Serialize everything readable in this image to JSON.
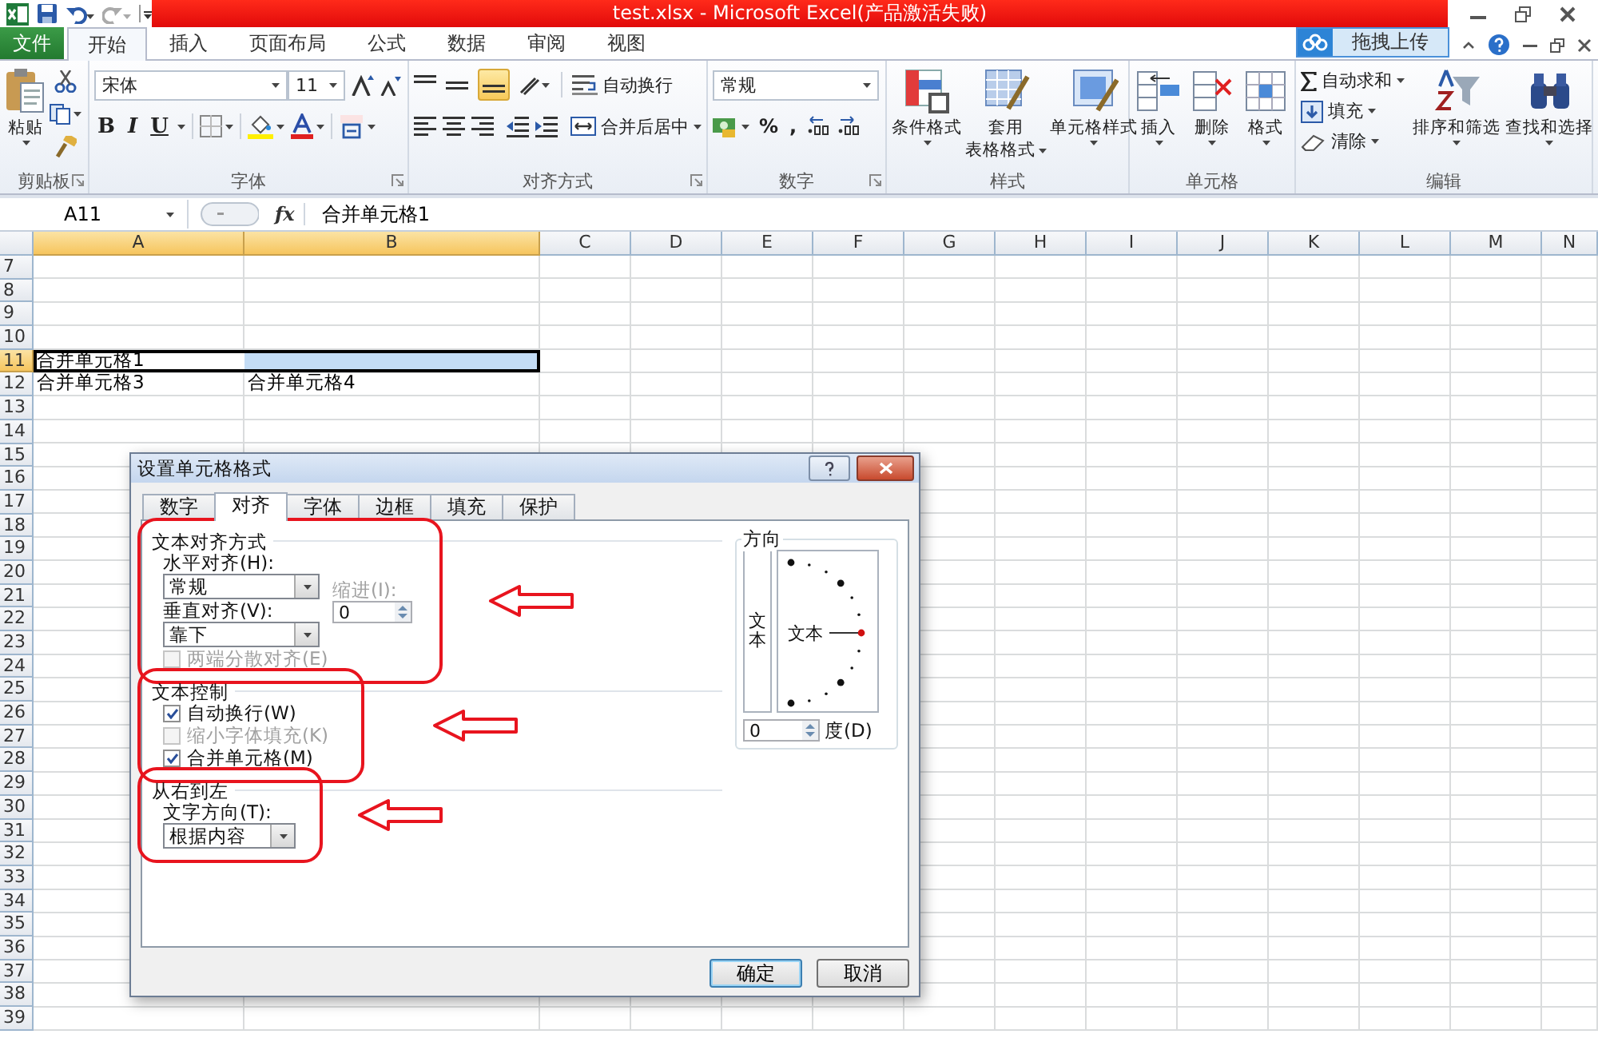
{
  "title_bar": {
    "title": "test.xlsx - Microsoft Excel(产品激活失败)"
  },
  "ribbon_tabs": [
    {
      "label": "文件",
      "kind": "file",
      "selected": false
    },
    {
      "label": "开始",
      "kind": "tab",
      "selected": true
    },
    {
      "label": "插入",
      "kind": "tab",
      "selected": false
    },
    {
      "label": "页面布局",
      "kind": "tab",
      "selected": false
    },
    {
      "label": "公式",
      "kind": "tab",
      "selected": false
    },
    {
      "label": "数据",
      "kind": "tab",
      "selected": false
    },
    {
      "label": "审阅",
      "kind": "tab",
      "selected": false
    },
    {
      "label": "视图",
      "kind": "tab",
      "selected": false
    }
  ],
  "upload_button": {
    "label": "拖拽上传"
  },
  "ribbon_groups": [
    {
      "kind": "clipboard",
      "title": "剪贴板",
      "paste_label": "粘贴"
    },
    {
      "kind": "font",
      "title": "字体",
      "font_name": "宋体",
      "font_size": "11",
      "style_buttons": [
        "B",
        "I",
        "U"
      ]
    },
    {
      "kind": "alignment",
      "title": "对齐方式",
      "bottom_align_selected": true,
      "wrap_label": "自动换行",
      "merge_label": "合并后居中"
    },
    {
      "kind": "number",
      "title": "数字",
      "format": "常规",
      "symbol_buttons": [
        "%",
        ","
      ]
    },
    {
      "kind": "styles",
      "title": "样式",
      "buttons": [
        {
          "lines": [
            "条件格式"
          ]
        },
        {
          "lines": [
            "套用",
            "表格格式"
          ]
        },
        {
          "lines": [
            "单元格样式"
          ]
        }
      ]
    },
    {
      "kind": "cells",
      "title": "单元格",
      "buttons": [
        {
          "lines": [
            "插入"
          ]
        },
        {
          "lines": [
            "删除"
          ]
        },
        {
          "lines": [
            "格式"
          ]
        }
      ]
    },
    {
      "kind": "editing",
      "title": "编辑",
      "small_buttons": [
        "自动求和",
        "填充",
        "清除"
      ],
      "buttons": [
        {
          "lines": [
            "排序和筛选"
          ]
        },
        {
          "lines": [
            "查找和选择"
          ]
        }
      ]
    }
  ],
  "formula_bar": {
    "name_box": "A11",
    "function_label": "fx",
    "formula": "合并单元格1"
  },
  "sheet": {
    "columns": [
      {
        "label": "A",
        "selected": true
      },
      {
        "label": "B",
        "selected": true
      },
      {
        "label": "C",
        "selected": false
      },
      {
        "label": "D",
        "selected": false
      },
      {
        "label": "E",
        "selected": false
      },
      {
        "label": "F",
        "selected": false
      },
      {
        "label": "G",
        "selected": false
      },
      {
        "label": "H",
        "selected": false
      },
      {
        "label": "I",
        "selected": false
      },
      {
        "label": "J",
        "selected": false
      },
      {
        "label": "K",
        "selected": false
      },
      {
        "label": "L",
        "selected": false
      },
      {
        "label": "M",
        "selected": false
      },
      {
        "label": "N",
        "selected": false
      }
    ],
    "rows": [
      {
        "label": "7",
        "selected": false
      },
      {
        "label": "8",
        "selected": false
      },
      {
        "label": "9",
        "selected": false
      },
      {
        "label": "10",
        "selected": false
      },
      {
        "label": "11",
        "selected": true,
        "cells": [
          {
            "text": "合并单元格1",
            "selected": true
          },
          {
            "selected": true
          }
        ]
      },
      {
        "label": "12",
        "selected": false,
        "cells": [
          {
            "text": "合并单元格3",
            "selected": false
          },
          {
            "text": "合并单元格4",
            "selected": false
          }
        ]
      },
      {
        "label": "13",
        "selected": false
      },
      {
        "label": "14",
        "selected": false
      },
      {
        "label": "15",
        "selected": false
      },
      {
        "label": "16",
        "selected": false
      },
      {
        "label": "17",
        "selected": false
      },
      {
        "label": "18",
        "selected": false
      },
      {
        "label": "19",
        "selected": false
      },
      {
        "label": "20",
        "selected": false
      },
      {
        "label": "21",
        "selected": false
      },
      {
        "label": "22",
        "selected": false
      },
      {
        "label": "23",
        "selected": false
      },
      {
        "label": "24",
        "selected": false
      },
      {
        "label": "25",
        "selected": false
      },
      {
        "label": "26",
        "selected": false
      },
      {
        "label": "27",
        "selected": false
      },
      {
        "label": "28",
        "selected": false
      },
      {
        "label": "29",
        "selected": false
      },
      {
        "label": "30",
        "selected": false
      },
      {
        "label": "31",
        "selected": false
      },
      {
        "label": "32",
        "selected": false
      },
      {
        "label": "33",
        "selected": false
      },
      {
        "label": "34",
        "selected": false
      },
      {
        "label": "35",
        "selected": false
      },
      {
        "label": "36",
        "selected": false
      },
      {
        "label": "37",
        "selected": false
      },
      {
        "label": "38",
        "selected": false
      },
      {
        "label": "39",
        "selected": false
      }
    ]
  },
  "dialog": {
    "title": "设置单元格格式",
    "tabs": [
      {
        "label": "数字",
        "selected": false
      },
      {
        "label": "对齐",
        "selected": true
      },
      {
        "label": "字体",
        "selected": false
      },
      {
        "label": "边框",
        "selected": false
      },
      {
        "label": "填充",
        "selected": false
      },
      {
        "label": "保护",
        "selected": false
      }
    ],
    "sections": [
      {
        "kind": "alignment",
        "title": "文本对齐方式",
        "highlighted": true,
        "horizontal_label": "水平对齐(H):",
        "horizontal_value": "常规",
        "indent_label": "缩进(I):",
        "indent_disabled": true,
        "indent_value": "0",
        "vertical_label": "垂直对齐(V):",
        "vertical_value": "靠下",
        "checkboxes": [
          {
            "label": "两端分散对齐(E)",
            "checked": false,
            "disabled": true
          }
        ]
      },
      {
        "kind": "control",
        "title": "文本控制",
        "highlighted": true,
        "checkboxes": [
          {
            "label": "自动换行(W)",
            "checked": true,
            "disabled": false
          },
          {
            "label": "缩小字体填充(K)",
            "checked": false,
            "disabled": true
          },
          {
            "label": "合并单元格(M)",
            "checked": true,
            "disabled": false
          }
        ]
      },
      {
        "kind": "direction",
        "title": "从右到左",
        "highlighted": true,
        "direction_label": "文字方向(T):",
        "direction_value": "根据内容"
      }
    ],
    "orientation": {
      "title": "方向",
      "vertical_text": "文本",
      "dial_text": "文本",
      "degrees_value": "0",
      "degrees_label": "度(D)"
    },
    "buttons": [
      {
        "label": "确定",
        "kind": "default"
      },
      {
        "label": "取消",
        "kind": "normal"
      }
    ]
  }
}
